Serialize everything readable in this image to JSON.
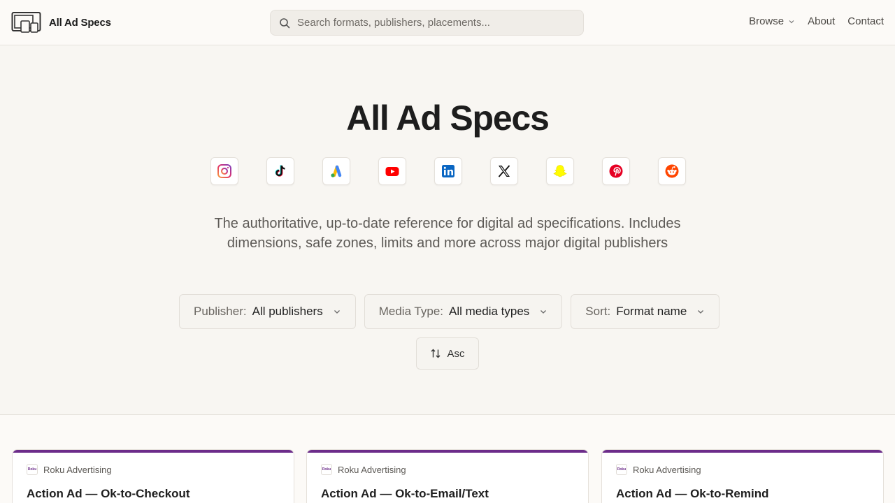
{
  "header": {
    "logo_text": "All Ad Specs",
    "search_placeholder": "Search formats, publishers, placements...",
    "nav": [
      {
        "label": "Browse",
        "has_dropdown": true
      },
      {
        "label": "About"
      },
      {
        "label": "Contact"
      }
    ]
  },
  "hero": {
    "title": "All Ad Specs",
    "publishers": [
      "instagram-icon",
      "tiktok-icon",
      "google-ads-icon",
      "youtube-icon",
      "linkedin-icon",
      "x-icon",
      "snapchat-icon",
      "pinterest-icon",
      "reddit-icon"
    ],
    "tagline": "The authoritative, up-to-date reference for digital ad specifications. Includes dimensions, safe zones, limits and more across major digital publishers"
  },
  "filters": {
    "publisher": {
      "label": "Publisher:",
      "value": "All publishers"
    },
    "media_type": {
      "label": "Media Type:",
      "value": "All media types"
    },
    "sort": {
      "label": "Sort:",
      "value": "Format name"
    },
    "order_label": "Asc"
  },
  "cards": [
    {
      "publisher": "Roku Advertising",
      "logo_text": "Roku",
      "title": "Action Ad — Ok-to-Checkout"
    },
    {
      "publisher": "Roku Advertising",
      "logo_text": "Roku",
      "title": "Action Ad — Ok-to-Email/Text"
    },
    {
      "publisher": "Roku Advertising",
      "logo_text": "Roku",
      "title": "Action Ad — Ok-to-Remind"
    }
  ],
  "colors": {
    "accent_card_border": "#6c2c8a",
    "background": "#f8f6f2"
  }
}
